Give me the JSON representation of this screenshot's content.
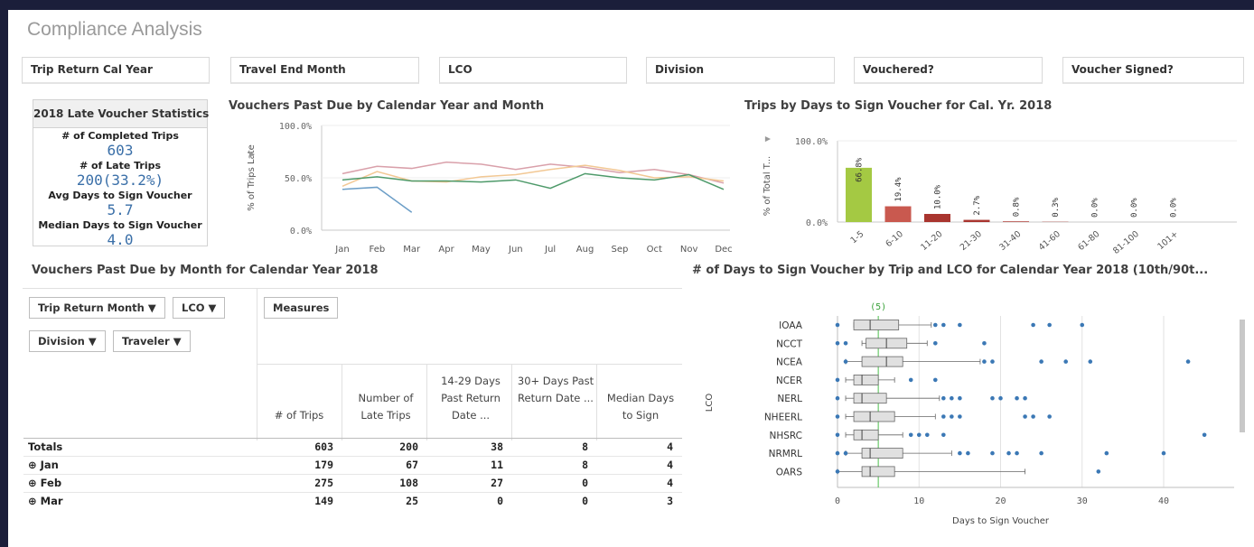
{
  "app": {
    "title": "Compliance Analysis"
  },
  "filters": [
    "Trip Return Cal Year",
    "Travel End Month",
    "LCO",
    "Division",
    "Vouchered?",
    "Voucher Signed?"
  ],
  "kpi": {
    "title": "2018 Late Voucher Statistics",
    "items": [
      {
        "label": "# of Completed Trips",
        "value": "603"
      },
      {
        "label": "# of Late Trips",
        "value": "200(33.2%)"
      },
      {
        "label": "Avg Days to Sign Voucher",
        "value": "5.7"
      },
      {
        "label": "Median Days to Sign Voucher",
        "value": "4.0"
      }
    ]
  },
  "line_chart": {
    "title": "Vouchers Past Due by Calendar Year and Month"
  },
  "bar_chart": {
    "title": "Trips by Days to Sign Voucher for Cal. Yr. 2018"
  },
  "table": {
    "title": "Vouchers Past Due by Month for Calendar Year 2018",
    "dims": [
      "Trip Return Month",
      "LCO",
      "Division",
      "Traveler"
    ],
    "measures_label": "Measures",
    "columns": [
      "# of Trips",
      "Number of Late Trips",
      "14-29 Days Past Return Date ...",
      "30+ Days Past Return Date ...",
      "Median Days to Sign"
    ],
    "rows": [
      {
        "label": "Totals",
        "expand": false,
        "values": [
          "603",
          "200",
          "38",
          "8",
          "4"
        ]
      },
      {
        "label": "Jan",
        "expand": true,
        "values": [
          "179",
          "67",
          "11",
          "8",
          "4"
        ]
      },
      {
        "label": "Feb",
        "expand": true,
        "values": [
          "275",
          "108",
          "27",
          "0",
          "4"
        ]
      },
      {
        "label": "Mar",
        "expand": true,
        "values": [
          "149",
          "25",
          "0",
          "0",
          "3"
        ]
      }
    ]
  },
  "boxplot": {
    "title": "# of Days to Sign Voucher by Trip and LCO for Calendar Year 2018 (10th/90t..."
  },
  "chart_data": [
    {
      "type": "line",
      "title": "Vouchers Past Due by Calendar Year and Month",
      "xlabel": "",
      "ylabel": "% of Trips Late",
      "categories": [
        "Jan",
        "Feb",
        "Mar",
        "Apr",
        "May",
        "Jun",
        "Jul",
        "Aug",
        "Sep",
        "Oct",
        "Nov",
        "Dec"
      ],
      "y_ticks": [
        "100.0%",
        "50.0%",
        "0.0%"
      ],
      "ylim": [
        0,
        100
      ],
      "series": [
        {
          "color": "#d9a0aa",
          "values": [
            54,
            61,
            59,
            65,
            63,
            58,
            63,
            60,
            55,
            58,
            53,
            45
          ]
        },
        {
          "color": "#f2c894",
          "values": [
            42,
            56,
            47,
            46,
            51,
            53,
            58,
            62,
            57,
            50,
            51,
            47
          ]
        },
        {
          "color": "#4e9a6a",
          "values": [
            48,
            51,
            47,
            47,
            46,
            48,
            40,
            54,
            50,
            48,
            53,
            39
          ]
        },
        {
          "color": "#6c9ec7",
          "values": [
            39,
            41,
            17,
            null,
            null,
            null,
            null,
            null,
            null,
            null,
            null,
            null
          ]
        }
      ]
    },
    {
      "type": "bar",
      "title": "Trips by Days to Sign Voucher for Cal. Yr. 2018",
      "xlabel": "",
      "ylabel": "% of Total T...",
      "y_ticks": [
        "100.0%",
        "0.0%"
      ],
      "ylim": [
        0,
        100
      ],
      "categories": [
        "1-5",
        "6-10",
        "11-20",
        "21-30",
        "31-40",
        "41-60",
        "61-80",
        "81-100",
        "101+"
      ],
      "values": [
        66.8,
        19.4,
        10.0,
        2.7,
        0.8,
        0.3,
        0.0,
        0.0,
        0.0
      ],
      "labels": [
        "66.8%",
        "19.4%",
        "10.0%",
        "2.7%",
        "0.8%",
        "0.3%",
        "0.0%",
        "0.0%",
        "0.0%"
      ],
      "colors": [
        "#a4c943",
        "#c9594f",
        "#a9352f",
        "#a9352f",
        "#a9352f",
        "#a9352f",
        "#a9352f",
        "#a9352f",
        "#a9352f"
      ]
    },
    {
      "type": "box",
      "title": "# of Days to Sign Voucher by Trip and LCO for Calendar Year 2018 (10th/90t...",
      "xlabel": "Days to Sign Voucher",
      "ylabel": "LCO",
      "xlim": [
        0,
        45
      ],
      "x_ticks": [
        0,
        10,
        20,
        30,
        40
      ],
      "reference": {
        "value": 5,
        "label": "(5)"
      },
      "categories": [
        "IOAA",
        "NCCT",
        "NCEA",
        "NCER",
        "NERL",
        "NHEERL",
        "NHSRC",
        "NRMRL",
        "OARS"
      ],
      "boxes": [
        {
          "whisker_low": 2,
          "q1": 2,
          "median": 4,
          "q3": 7.5,
          "whisker_high": 11.5,
          "outliers": [
            0,
            12,
            13,
            15,
            24,
            26,
            30
          ]
        },
        {
          "whisker_low": 3,
          "q1": 3.5,
          "median": 6,
          "q3": 8.5,
          "whisker_high": 11,
          "outliers": [
            0,
            1,
            12,
            18
          ]
        },
        {
          "whisker_low": 1,
          "q1": 3,
          "median": 6,
          "q3": 8,
          "whisker_high": 17.5,
          "outliers": [
            1,
            18,
            19,
            25,
            28,
            31,
            43
          ]
        },
        {
          "whisker_low": 1,
          "q1": 2,
          "median": 3,
          "q3": 5,
          "whisker_high": 7,
          "outliers": [
            0,
            9,
            12
          ]
        },
        {
          "whisker_low": 1,
          "q1": 2,
          "median": 3,
          "q3": 6,
          "whisker_high": 12.5,
          "outliers": [
            0,
            13,
            14,
            15,
            19,
            20,
            22,
            23
          ]
        },
        {
          "whisker_low": 1,
          "q1": 2,
          "median": 4,
          "q3": 7,
          "whisker_high": 12,
          "outliers": [
            0,
            13,
            14,
            15,
            23,
            24,
            26
          ]
        },
        {
          "whisker_low": 1,
          "q1": 2,
          "median": 3,
          "q3": 5,
          "whisker_high": 8,
          "outliers": [
            0,
            9,
            10,
            11,
            13,
            45
          ]
        },
        {
          "whisker_low": 1,
          "q1": 3,
          "median": 4,
          "q3": 8,
          "whisker_high": 14,
          "outliers": [
            0,
            1,
            15,
            16,
            19,
            21,
            22,
            25,
            33,
            40
          ]
        },
        {
          "whisker_low": 0,
          "q1": 3,
          "median": 4,
          "q3": 7,
          "whisker_high": 23,
          "outliers": [
            0,
            32
          ]
        }
      ]
    }
  ]
}
